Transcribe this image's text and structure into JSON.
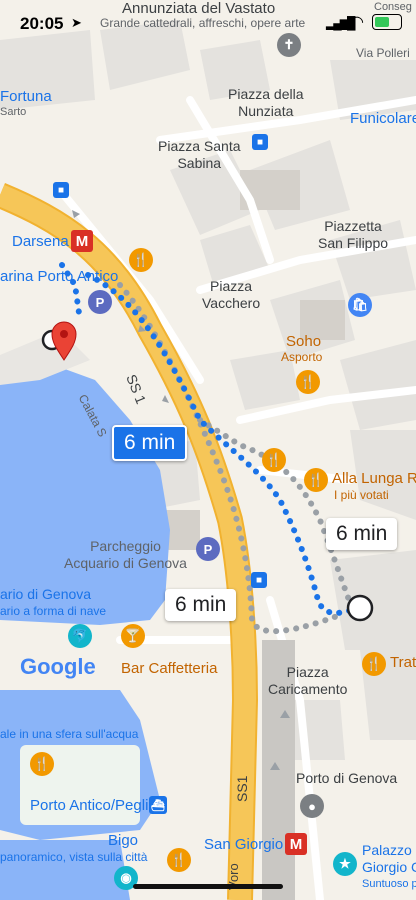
{
  "status": {
    "time": "20:05"
  },
  "places": {
    "annunziata": "Annunziata del Vastato",
    "annunziata_sub": "Grande cattedrali, affreschi, opere arte",
    "piazza_nunziata": "Piazza della\nNunziata",
    "piazza_santa_sabina": "Piazza Santa\nSabina",
    "piazzetta_san_filippo": "Piazzetta\nSan Filippo",
    "piazza_vacchero": "Piazza\nVacchero",
    "via_polleri": "Via Polleri",
    "fortuna": "Fortuna",
    "sarto": "Sarto",
    "funicolare": "Funicolare",
    "darsena": "Darsena",
    "marina_porto_antico": "arina Porto Antico",
    "soho": "Soho",
    "soho_sub": "Asporto",
    "alla_lunga": "Alla Lunga R",
    "alla_lunga_sub": "I più votati",
    "parcheggio": "Parcheggio\nAcquario di Genova",
    "acquario": "ario di Genova",
    "acquario_sub": "ario a forma di nave",
    "bar_caffetteria": "Bar Caffetteria",
    "piazza_caricamento": "Piazza\nCaricamento",
    "trattoria": "Tratt",
    "sfera": "ale in una sfera sull'acqua",
    "porto_antico_pegli": "Porto Antico/Pegli",
    "porto_di_genova": "Porto di Genova",
    "bigo": "Bigo",
    "bigo_sub": "panoramico, vista sulla città",
    "san_giorgio": "San Giorgio",
    "palazzo": "Palazzo S\nGiorgio C",
    "palazzo_sub": "Suntuoso p",
    "calata": "Calata S",
    "consegna": "Conseg",
    "road_ss1": "SS 1",
    "road_ss1_b": "SS1",
    "road_voro": "Voro",
    "google": "Google"
  },
  "routes": [
    {
      "label": "6 min",
      "selected": true
    },
    {
      "label": "6 min",
      "selected": false
    },
    {
      "label": "6 min",
      "selected": false
    }
  ],
  "colors": {
    "route": "#1a73e8",
    "alt_route": "#9aa0a6",
    "highway": "#f6c658",
    "water": "#8ab4f8"
  }
}
